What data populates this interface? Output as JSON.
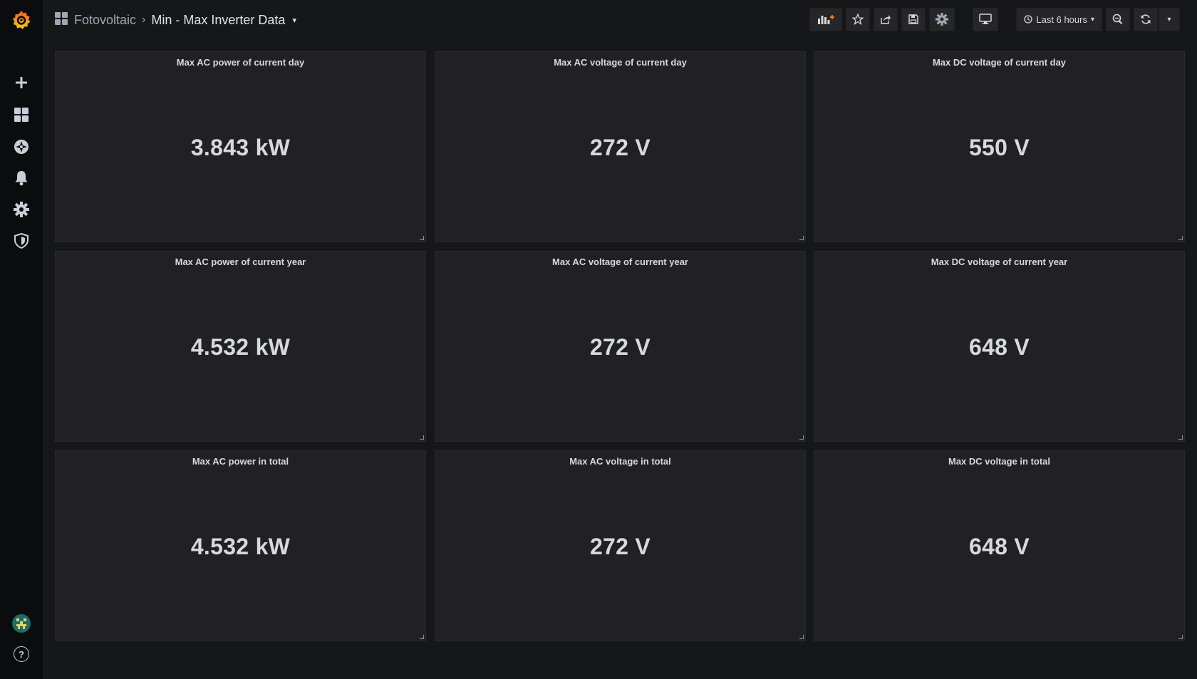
{
  "breadcrumb": {
    "folder": "Fotovoltaic",
    "separator": "›",
    "dashboard": "Min - Max Inverter Data",
    "caret": "▾"
  },
  "toolbar": {
    "time_range": "Last 6 hours",
    "caret": "▾"
  },
  "colors": {
    "background": "#161719",
    "sidemenu": "#0b0c0e",
    "panel": "#212124",
    "text": "#d8d9da",
    "accent": "#eb7b18"
  },
  "sidemenu": {
    "items": [
      "create",
      "dashboards",
      "explore",
      "alerting",
      "configuration",
      "server-admin"
    ],
    "bottom": [
      "user-avatar",
      "help"
    ],
    "help_label": "?"
  },
  "panels": [
    {
      "title": "Max AC power of current day",
      "value": "3.843 kW"
    },
    {
      "title": "Max AC voltage of current day",
      "value": "272 V"
    },
    {
      "title": "Max DC voltage of current day",
      "value": "550 V"
    },
    {
      "title": "Max AC power of current year",
      "value": "4.532 kW"
    },
    {
      "title": "Max AC voltage of current year",
      "value": "272 V"
    },
    {
      "title": "Max DC voltage of current year",
      "value": "648 V"
    },
    {
      "title": "Max AC power in total",
      "value": "4.532 kW"
    },
    {
      "title": "Max AC voltage in total",
      "value": "272 V"
    },
    {
      "title": "Max DC voltage in total",
      "value": "648 V"
    }
  ]
}
